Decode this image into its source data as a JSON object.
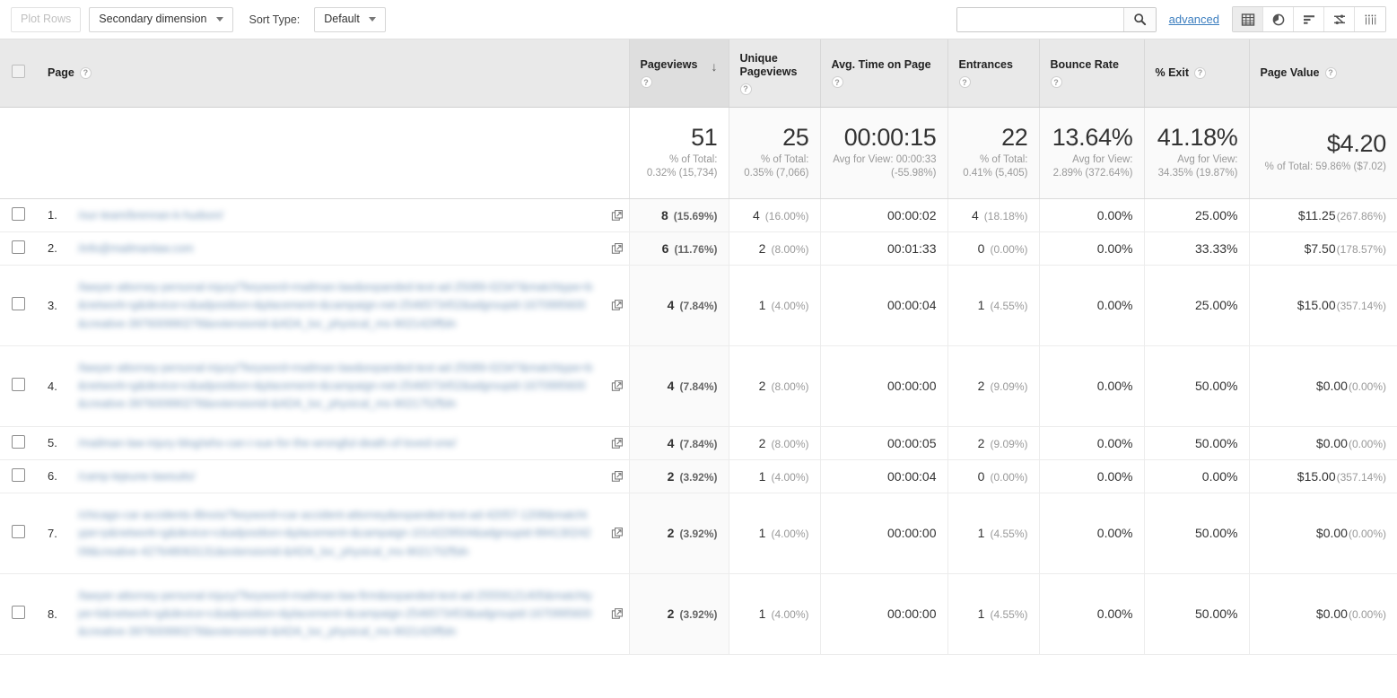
{
  "toolbar": {
    "plot_rows_label": "Plot Rows",
    "secondary_dimension_label": "Secondary dimension",
    "sort_type_label": "Sort Type:",
    "sort_type_value": "Default",
    "search_value": "",
    "search_placeholder": "",
    "advanced_label": "advanced",
    "view_icons": [
      {
        "name": "table-view-icon",
        "active": true
      },
      {
        "name": "pie-chart-view-icon",
        "active": false
      },
      {
        "name": "performance-bar-view-icon",
        "active": false
      },
      {
        "name": "comparison-view-icon",
        "active": false
      },
      {
        "name": "pivot-view-icon",
        "active": false
      }
    ],
    "accent_link_color": "#3c7ebf"
  },
  "table": {
    "columns": [
      {
        "key": "page",
        "label": "Page",
        "help": "?"
      },
      {
        "key": "pageviews",
        "label": "Pageviews",
        "help": "?",
        "sorted": true,
        "sort_direction": "desc",
        "sort_glyph": "↓"
      },
      {
        "key": "unique_pageviews",
        "label": "Unique Pageviews",
        "help": "?"
      },
      {
        "key": "avg_time_on_page",
        "label": "Avg. Time on Page",
        "help": "?"
      },
      {
        "key": "entrances",
        "label": "Entrances",
        "help": "?"
      },
      {
        "key": "bounce_rate",
        "label": "Bounce Rate",
        "help": "?"
      },
      {
        "key": "pct_exit",
        "label": "% Exit",
        "help": "?"
      },
      {
        "key": "page_value",
        "label": "Page Value",
        "help": "?"
      }
    ],
    "summary": {
      "pageviews": {
        "value": "51",
        "sub": "% of Total: 0.32% (15,734)"
      },
      "unique_pageviews": {
        "value": "25",
        "sub": "% of Total: 0.35% (7,066)"
      },
      "avg_time_on_page": {
        "value": "00:00:15",
        "sub": "Avg for View: 00:00:33 (-55.98%)"
      },
      "entrances": {
        "value": "22",
        "sub": "% of Total: 0.41% (5,405)"
      },
      "bounce_rate": {
        "value": "13.64%",
        "sub": "Avg for View: 2.89% (372.64%)"
      },
      "pct_exit": {
        "value": "41.18%",
        "sub": "Avg for View: 34.35% (19.87%)"
      },
      "page_value": {
        "value": "$4.20",
        "sub": "% of Total: 59.86% ($7.02)"
      }
    },
    "rows": [
      {
        "index": "1.",
        "page": "/our-team/brennan-k-hudson/",
        "redacted": true,
        "lines": 1,
        "pageviews": "8",
        "pageviews_pct": "(15.69%)",
        "unique_pageviews": "4",
        "unique_pageviews_pct": "(16.00%)",
        "avg_time_on_page": "00:00:02",
        "entrances": "4",
        "entrances_pct": "(18.18%)",
        "bounce_rate": "0.00%",
        "pct_exit": "25.00%",
        "page_value": "$11.25",
        "page_value_pct": "(267.86%)"
      },
      {
        "index": "2.",
        "page": "/info@mailmanlaw.com",
        "redacted": true,
        "lines": 1,
        "pageviews": "6",
        "pageviews_pct": "(11.76%)",
        "unique_pageviews": "2",
        "unique_pageviews_pct": "(8.00%)",
        "avg_time_on_page": "00:01:33",
        "entrances": "0",
        "entrances_pct": "(0.00%)",
        "bounce_rate": "0.00%",
        "pct_exit": "33.33%",
        "page_value": "$7.50",
        "page_value_pct": "(178.57%)"
      },
      {
        "index": "3.",
        "page": "/lawyer-attorney-personal-injury/?keyword=mailman-law&expanded-text-ad-25089-0234?&matchtype=b&network=g&device=c&adposition=&placement=&campaign-net-2546573452&adgroupid-1670995600&creative-397600990278&extensionid-&ADA_loc_physical_ms-9021429&paradn",
        "redacted": true,
        "lines": 4,
        "pageviews": "4",
        "pageviews_pct": "(7.84%)",
        "unique_pageviews": "1",
        "unique_pageviews_pct": "(4.00%)",
        "avg_time_on_page": "00:00:04",
        "entrances": "1",
        "entrances_pct": "(4.55%)",
        "bounce_rate": "0.00%",
        "pct_exit": "25.00%",
        "page_value": "$15.00",
        "page_value_pct": "(357.14%)"
      },
      {
        "index": "4.",
        "page": "/lawyer-attorney-personal-injury/?keyword=mailman-law&expanded-text-ad-25089-0234?&matchtype=b&network=g&device=c&adposition=&placement=&campaign-net-2546573452&adgroupid-1670995600&creative-397600990278&extensionid-&ADA_loc_physical_ms-9021752&paradn",
        "redacted": true,
        "lines": 4,
        "pageviews": "4",
        "pageviews_pct": "(7.84%)",
        "unique_pageviews": "2",
        "unique_pageviews_pct": "(8.00%)",
        "avg_time_on_page": "00:00:00",
        "entrances": "2",
        "entrances_pct": "(9.09%)",
        "bounce_rate": "0.00%",
        "pct_exit": "50.00%",
        "page_value": "$0.00",
        "page_value_pct": "(0.00%)"
      },
      {
        "index": "5.",
        "page": "/mailman-law-injury-blog/who-can-i-sue-for-the-wrongful-death-of-loved-one/",
        "redacted": true,
        "lines": 1,
        "pageviews": "4",
        "pageviews_pct": "(7.84%)",
        "unique_pageviews": "2",
        "unique_pageviews_pct": "(8.00%)",
        "avg_time_on_page": "00:00:05",
        "entrances": "2",
        "entrances_pct": "(9.09%)",
        "bounce_rate": "0.00%",
        "pct_exit": "50.00%",
        "page_value": "$0.00",
        "page_value_pct": "(0.00%)"
      },
      {
        "index": "6.",
        "page": "/camp-lejeune-lawsuits/",
        "redacted": true,
        "lines": 1,
        "pageviews": "2",
        "pageviews_pct": "(3.92%)",
        "unique_pageviews": "1",
        "unique_pageviews_pct": "(4.00%)",
        "avg_time_on_page": "00:00:04",
        "entrances": "0",
        "entrances_pct": "(0.00%)",
        "bounce_rate": "0.00%",
        "pct_exit": "0.00%",
        "page_value": "$15.00",
        "page_value_pct": "(357.14%)"
      },
      {
        "index": "7.",
        "page": "/chicago-car-accidents-illinois/?keyword=car-accident-attorney&expanded-text-ad-42057-1208&matchtype=p&network=g&device=c&adposition=&placement=&campaign-1014229504&adgroupid-99413024209&creative-427648063131&extensionid-&ADA_loc_physical_ms-9021702&paradn",
        "redacted": true,
        "lines": 4,
        "pageviews": "2",
        "pageviews_pct": "(3.92%)",
        "unique_pageviews": "1",
        "unique_pageviews_pct": "(4.00%)",
        "avg_time_on_page": "00:00:00",
        "entrances": "1",
        "entrances_pct": "(4.55%)",
        "bounce_rate": "0.00%",
        "pct_exit": "50.00%",
        "page_value": "$0.00",
        "page_value_pct": "(0.00%)"
      },
      {
        "index": "8.",
        "page": "/lawyer-attorney-personal-injury/?keyword=mailman-law-firm&expanded-text-ad-25559121405&matchtype=b&network=g&device=c&adposition=&placement=&campaign-2546573453&adgroupid-1670995600&creative-397600990278&extensionid-&ADA_loc_physical_ms-9021429&paradn",
        "redacted": true,
        "lines": 4,
        "pageviews": "2",
        "pageviews_pct": "(3.92%)",
        "unique_pageviews": "1",
        "unique_pageviews_pct": "(4.00%)",
        "avg_time_on_page": "00:00:00",
        "entrances": "1",
        "entrances_pct": "(4.55%)",
        "bounce_rate": "0.00%",
        "pct_exit": "50.00%",
        "page_value": "$0.00",
        "page_value_pct": "(0.00%)"
      }
    ]
  }
}
